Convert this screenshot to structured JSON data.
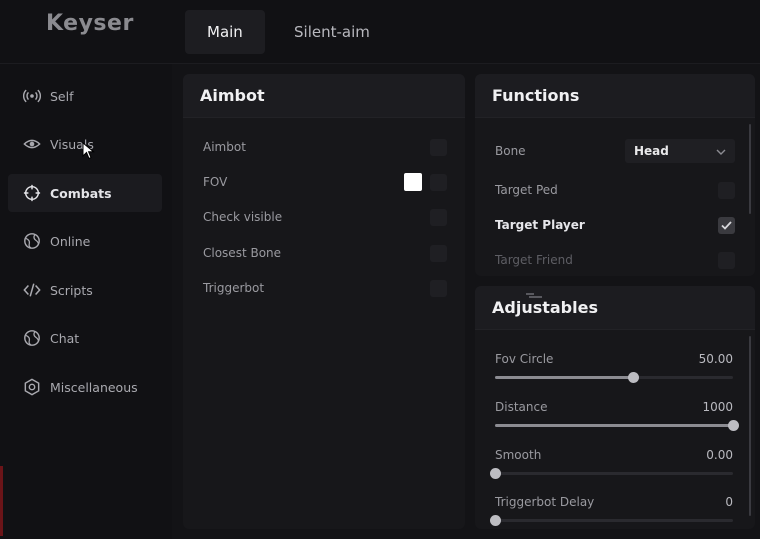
{
  "app": {
    "title": "Keyser"
  },
  "tabs": [
    {
      "label": "Main",
      "active": true
    },
    {
      "label": "Silent-aim",
      "active": false
    }
  ],
  "sidebar": {
    "items": [
      {
        "label": "Self",
        "icon": "broadcast-icon"
      },
      {
        "label": "Visuals",
        "icon": "eye-icon"
      },
      {
        "label": "Combats",
        "icon": "crosshair-icon",
        "active": true
      },
      {
        "label": "Online",
        "icon": "globe-icon"
      },
      {
        "label": "Scripts",
        "icon": "code-icon"
      },
      {
        "label": "Chat",
        "icon": "globe-icon"
      },
      {
        "label": "Miscellaneous",
        "icon": "gear-icon"
      }
    ]
  },
  "aimbot": {
    "title": "Aimbot",
    "options": [
      {
        "label": "Aimbot",
        "checked": false
      },
      {
        "label": "FOV",
        "checked": false,
        "color": "#ffffff"
      },
      {
        "label": "Check visible",
        "checked": false
      },
      {
        "label": "Closest Bone",
        "checked": false
      },
      {
        "label": "Triggerbot",
        "checked": false
      }
    ]
  },
  "functions": {
    "title": "Functions",
    "bone": {
      "label": "Bone",
      "value": "Head"
    },
    "options": [
      {
        "label": "Target Ped",
        "checked": false
      },
      {
        "label": "Target Player",
        "checked": true
      },
      {
        "label": "Target Friend",
        "checked": false
      }
    ]
  },
  "adjustables": {
    "title": "Adjustables",
    "sliders": [
      {
        "label": "Fov Circle",
        "value": "50.00",
        "fraction": 0.58
      },
      {
        "label": "Distance",
        "value": "1000",
        "fraction": 1.0
      },
      {
        "label": "Smooth",
        "value": "0.00",
        "fraction": 0.0
      },
      {
        "label": "Triggerbot Delay",
        "value": "0",
        "fraction": 0.0
      }
    ]
  },
  "colors": {
    "accent": "#8c8c92",
    "background": "#131316",
    "panel": "#17171a"
  }
}
